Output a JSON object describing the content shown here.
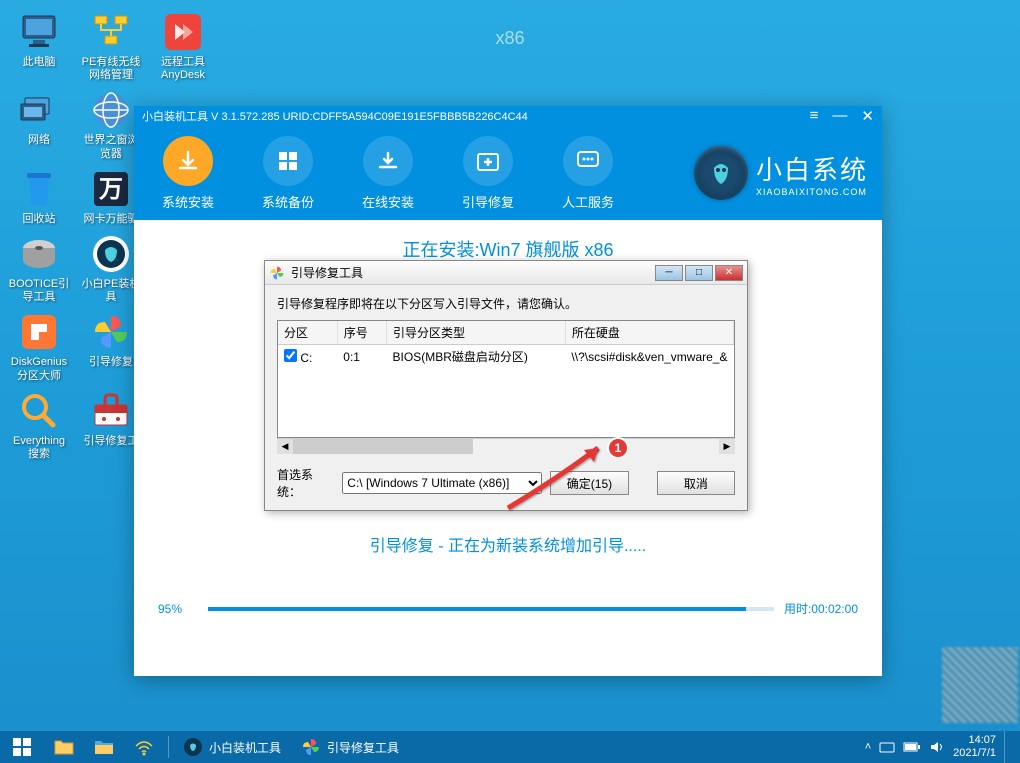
{
  "watermark": "x86",
  "desktop_icons": {
    "row1": [
      "此电脑",
      "PE有线无线网络管理",
      "远程工具AnyDesk"
    ],
    "row2": [
      "网络",
      "世界之窗浏览器"
    ],
    "row3": [
      "回收站",
      "网卡万能驱"
    ],
    "row4": [
      "BOOTICE引导工具",
      "小白PE装机具"
    ],
    "row5": [
      "DiskGenius分区大师",
      "引导修复"
    ],
    "row6": [
      "Everything搜索",
      "引导修复工"
    ]
  },
  "installer": {
    "title": "小白装机工具 V 3.1.572.285 URID:CDFF5A594C09E191E5FBBB5B226C4C44",
    "tabs": [
      "系统安装",
      "系统备份",
      "在线安装",
      "引导修复",
      "人工服务"
    ],
    "brand_cn": "小白系统",
    "brand_en": "XIAOBAIXITONG.COM",
    "installing": "正在安装:Win7 旗舰版 x86",
    "status": "引导修复 - 正在为新装系统增加引导.....",
    "progress_pct": "95%",
    "progress_value": 95,
    "elapsed_label": "用时:",
    "elapsed": "00:02:00"
  },
  "dialog": {
    "title": "引导修复工具",
    "message": "引导修复程序即将在以下分区写入引导文件，请您确认。",
    "headers": [
      "分区",
      "序号",
      "引导分区类型",
      "所在硬盘"
    ],
    "row": {
      "part": "C:",
      "seq": "0:1",
      "type": "BIOS(MBR磁盘启动分区)",
      "disk": "\\\\?\\scsi#disk&ven_vmware_&"
    },
    "sys_label": "首选系统：",
    "sys_value": "C:\\ [Windows 7 Ultimate (x86)]",
    "ok": "确定(15)",
    "cancel": "取消",
    "annot_num": "1"
  },
  "taskbar": {
    "apps": [
      "小白装机工具",
      "引导修复工具"
    ],
    "time": "14:07",
    "date": "2021/7/1"
  }
}
